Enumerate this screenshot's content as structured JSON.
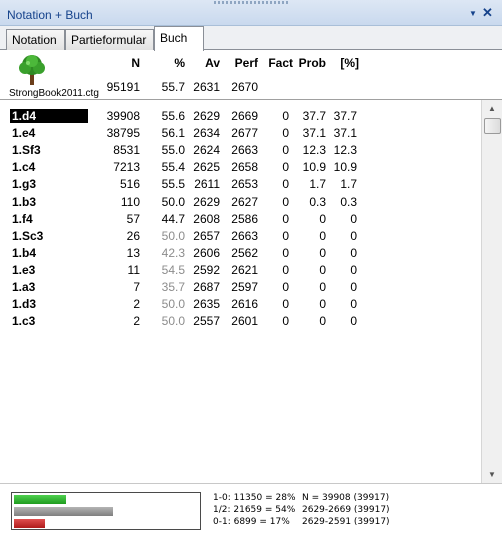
{
  "window": {
    "title": "Notation + Buch",
    "pin_icon": "▼",
    "close_icon": "✕"
  },
  "tabs": [
    {
      "label": "Notation",
      "active": false
    },
    {
      "label": "Partieformular",
      "active": false
    },
    {
      "label": "Buch",
      "active": true
    }
  ],
  "columns": [
    "N",
    "%",
    "Av",
    "Perf",
    "Fact",
    "Prob",
    "[%]"
  ],
  "database": {
    "name": "StrongBook2011.ctg",
    "n": "95191",
    "pct": "55.7",
    "av": "2631",
    "perf": "2670"
  },
  "moves": [
    {
      "move": "1.d4",
      "n": "39908",
      "pct": "55.6",
      "av": "2629",
      "perf": "2669",
      "fact": "0",
      "prob": "37.7",
      "pp": "37.7",
      "pct_grey": false,
      "selected": true
    },
    {
      "move": "1.e4",
      "n": "38795",
      "pct": "56.1",
      "av": "2634",
      "perf": "2677",
      "fact": "0",
      "prob": "37.1",
      "pp": "37.1",
      "pct_grey": false,
      "selected": false
    },
    {
      "move": "1.Sf3",
      "n": "8531",
      "pct": "55.0",
      "av": "2624",
      "perf": "2663",
      "fact": "0",
      "prob": "12.3",
      "pp": "12.3",
      "pct_grey": false,
      "selected": false
    },
    {
      "move": "1.c4",
      "n": "7213",
      "pct": "55.4",
      "av": "2625",
      "perf": "2658",
      "fact": "0",
      "prob": "10.9",
      "pp": "10.9",
      "pct_grey": false,
      "selected": false
    },
    {
      "move": "1.g3",
      "n": "516",
      "pct": "55.5",
      "av": "2611",
      "perf": "2653",
      "fact": "0",
      "prob": "1.7",
      "pp": "1.7",
      "pct_grey": false,
      "selected": false
    },
    {
      "move": "1.b3",
      "n": "110",
      "pct": "50.0",
      "av": "2629",
      "perf": "2627",
      "fact": "0",
      "prob": "0.3",
      "pp": "0.3",
      "pct_grey": false,
      "selected": false
    },
    {
      "move": "1.f4",
      "n": "57",
      "pct": "44.7",
      "av": "2608",
      "perf": "2586",
      "fact": "0",
      "prob": "0",
      "pp": "0",
      "pct_grey": false,
      "selected": false
    },
    {
      "move": "1.Sc3",
      "n": "26",
      "pct": "50.0",
      "av": "2657",
      "perf": "2663",
      "fact": "0",
      "prob": "0",
      "pp": "0",
      "pct_grey": true,
      "selected": false
    },
    {
      "move": "1.b4",
      "n": "13",
      "pct": "42.3",
      "av": "2606",
      "perf": "2562",
      "fact": "0",
      "prob": "0",
      "pp": "0",
      "pct_grey": true,
      "selected": false
    },
    {
      "move": "1.e3",
      "n": "11",
      "pct": "54.5",
      "av": "2592",
      "perf": "2621",
      "fact": "0",
      "prob": "0",
      "pp": "0",
      "pct_grey": true,
      "selected": false
    },
    {
      "move": "1.a3",
      "n": "7",
      "pct": "35.7",
      "av": "2687",
      "perf": "2597",
      "fact": "0",
      "prob": "0",
      "pp": "0",
      "pct_grey": true,
      "selected": false
    },
    {
      "move": "1.d3",
      "n": "2",
      "pct": "50.0",
      "av": "2635",
      "perf": "2616",
      "fact": "0",
      "prob": "0",
      "pp": "0",
      "pct_grey": true,
      "selected": false
    },
    {
      "move": "1.c3",
      "n": "2",
      "pct": "50.0",
      "av": "2557",
      "perf": "2601",
      "fact": "0",
      "prob": "0",
      "pp": "0",
      "pct_grey": true,
      "selected": false
    }
  ],
  "footer": {
    "bars": {
      "win_fraction": 0.28,
      "draw_fraction": 0.54,
      "loss_fraction": 0.17
    },
    "results": [
      "1-0: 11350 = 28%",
      "1/2: 21659 = 54%",
      "0-1: 6899 = 17%"
    ],
    "summary": [
      "N = 39908 (39917)",
      "2629-2669 (39917)",
      "2629-2591 (39917)"
    ]
  },
  "colors": {
    "win": "#22a822",
    "draw": "#8f8f8f",
    "loss": "#c02424",
    "title_text": "#15428b"
  }
}
